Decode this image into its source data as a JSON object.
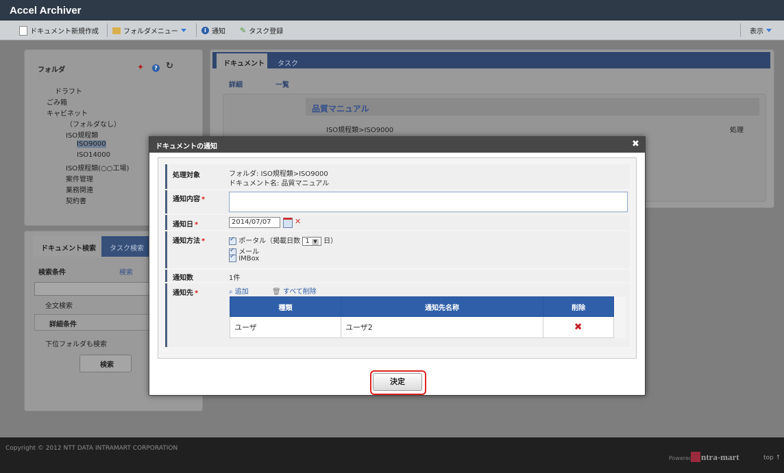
{
  "app": {
    "title": "Accel Archiver"
  },
  "menu": {
    "new_doc": "ドキュメント新規作成",
    "folder_menu": "フォルダメニュー",
    "notify": "通知",
    "task_register": "タスク登録",
    "view": "表示"
  },
  "left": {
    "folder_header": "フォルダ",
    "tree": [
      "ドラフト",
      "ごみ箱",
      "キャビネット",
      "（フォルダなし）",
      "ISO規程類",
      "ISO9000",
      "ISO14000",
      "ISO規程類(○○工場)",
      "案件管理",
      "業務関連",
      "契約書"
    ],
    "search_tab": "ドキュメント検索",
    "task_search_tab": "タスク検索",
    "search_condition": "検索条件",
    "search_link": "検索",
    "fulltext": "全文検索",
    "detail_condition": "詳細条件",
    "subfolder": "下位フォルダも検索",
    "search_button": "検索"
  },
  "main": {
    "tab_doc": "ドキュメント",
    "tab_task": "タスク",
    "sub_detail": "詳細",
    "sub_list": "一覧",
    "doc_title": "品質マニュアル",
    "doc_path": "ISO規程類>ISO9000",
    "action": "処理"
  },
  "modal": {
    "title": "ドキュメントの通知",
    "target_label": "処理対象",
    "target_folder": "フォルダ: ISO規程類>ISO9000",
    "target_doc": "ドキュメント名: 品質マニュアル",
    "content_label": "通知内容",
    "content_value": "",
    "date_label": "通知日",
    "date_value": "2014/07/07",
    "method_label": "通知方法",
    "method_portal_prefix": "ポータル（掲載日数",
    "method_portal_days": "1",
    "method_portal_suffix": "日）",
    "method_mail": "メール",
    "method_imbox": "IMBox",
    "count_label": "通知数",
    "count_value": "1件",
    "dest_label": "通知先",
    "add_link": "追加",
    "delete_all_link": "すべて削除",
    "table_headers": [
      "種類",
      "通知先名称",
      "削除"
    ],
    "rows": [
      {
        "type": "ユーザ",
        "name": "ユーザ2"
      }
    ],
    "confirm": "決定",
    "required_mark": "*"
  },
  "footer": {
    "copyright": "Copyright © 2012 NTT DATA INTRAMART CORPORATION",
    "powered": "Powered by",
    "brand": "ntra-mart",
    "top": "top ↑"
  },
  "colors": {
    "accent": "#2f5fa8",
    "required": "#dd2222",
    "header_bg": "#2e3a47"
  }
}
